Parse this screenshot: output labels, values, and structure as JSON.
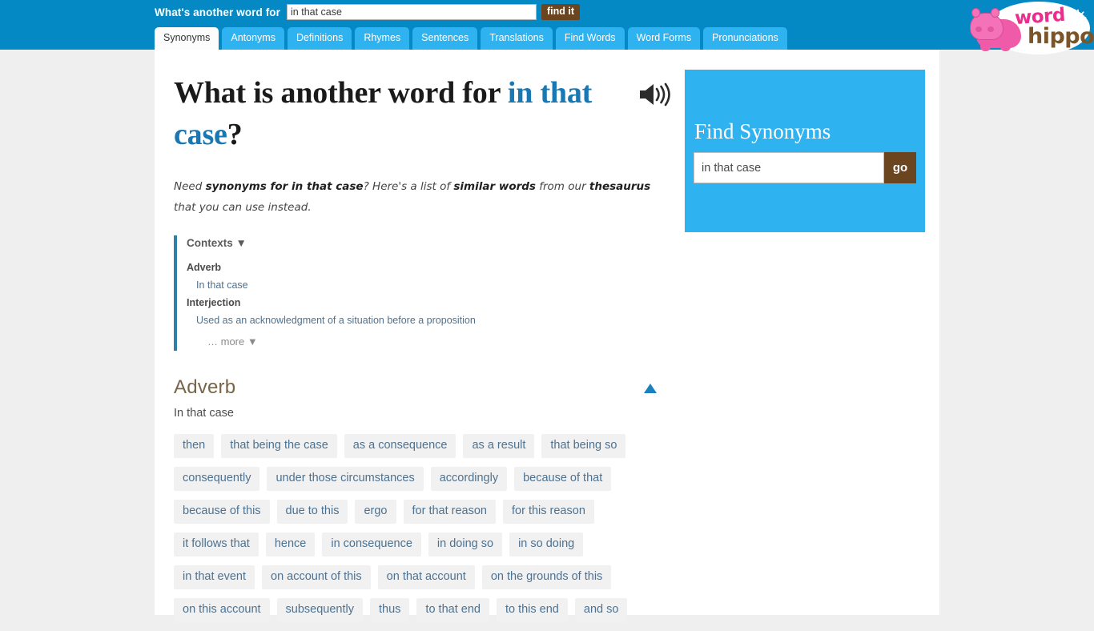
{
  "header": {
    "search_label": "What's another word for",
    "search_value": "in that case",
    "search_placeholder": "",
    "find_button": "find it",
    "logo_word": "word",
    "logo_hippo": "hippo",
    "theme_icon": "sun-icon",
    "tabs": [
      {
        "label": "Synonyms",
        "active": true
      },
      {
        "label": "Antonyms",
        "active": false
      },
      {
        "label": "Definitions",
        "active": false
      },
      {
        "label": "Rhymes",
        "active": false
      },
      {
        "label": "Sentences",
        "active": false
      },
      {
        "label": "Translations",
        "active": false
      },
      {
        "label": "Find Words",
        "active": false
      },
      {
        "label": "Word Forms",
        "active": false
      },
      {
        "label": "Pronunciations",
        "active": false
      }
    ]
  },
  "main": {
    "heading_prefix": "What is another word for ",
    "heading_term": "in that case",
    "heading_suffix": "?",
    "speaker_icon": "speaker-icon",
    "blurb": {
      "p1": "Need ",
      "b1": "synonyms for in that case",
      "p2": "? Here's a list of ",
      "b2": "similar words",
      "p3": " from our ",
      "b3": "thesaurus",
      "p4": " that you can use instead."
    },
    "contexts": {
      "title": "Contexts",
      "title_caret": "▼",
      "entries": [
        {
          "pos": "Adverb",
          "definition": "In that case"
        },
        {
          "pos": "Interjection",
          "definition": "Used as an acknowledgment of a situation before a proposition"
        }
      ],
      "more_label": "… more ▼"
    },
    "sections": [
      {
        "pos": "Adverb",
        "sense": "In that case",
        "collapse_icon": "triangle-up-icon",
        "chips": [
          "then",
          "that being the case",
          "as a consequence",
          "as a result",
          "that being so",
          "consequently",
          "under those circumstances",
          "accordingly",
          "because of that",
          "because of this",
          "due to this",
          "ergo",
          "for that reason",
          "for this reason",
          "it follows that",
          "hence",
          "in consequence",
          "in doing so",
          "in so doing",
          "in that event",
          "on account of this",
          "on that account",
          "on the grounds of this",
          "on this account",
          "subsequently",
          "thus",
          "to that end",
          "to this end",
          "and so"
        ]
      }
    ]
  },
  "sidebar": {
    "find_title": "Find Synonyms",
    "find_value": "in that case",
    "find_placeholder": "",
    "go_label": "go"
  },
  "colors": {
    "topbar_blue": "#0589c4",
    "accent_blue": "#2fb2f0",
    "link_blue": "#1878b4",
    "brown": "#6b451f",
    "chip_bg": "#f1f1f1",
    "chip_text": "#4d7291",
    "pos_brown": "#77654a",
    "page_bg": "#efefef"
  }
}
